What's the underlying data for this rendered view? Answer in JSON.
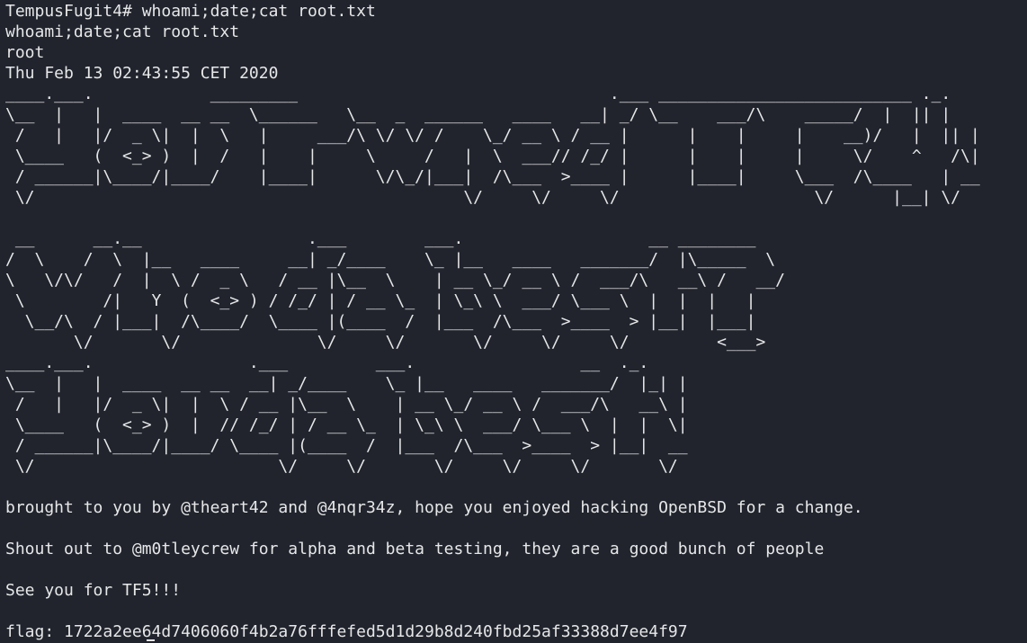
{
  "terminal": {
    "prompt_line": "TempusFugit4# whoami;date;cat root.txt",
    "echo_line": "whoami;date;cat root.txt",
    "user_line": "root",
    "date_line": "Thu Feb 13 02:43:55 CET 2020",
    "art1": [
      "____.___.            _________                                .___ __________________________ ._.",
      "\\__  |   |  ____  __ __  \\______   \\__  _  ______   ____   __| _/ \\__    ___/\\    _____/  |  || |",
      " /   |   |/  _ \\|  |  \\   |     ___/\\ \\/ \\/ /    \\_/ __ \\ / __ |      |    |     |    __)/   |  || |",
      " \\____   (  <_> )  |  /   |    |     \\     /   |  \\  ___// /_/ |      |    |     |     \\/    ^   /\\|",
      " / ______|\\____/|____/    |____|      \\/\\_/|___|  /\\___  >____ |      |____|     \\___  /\\____   | __",
      " \\/                                            \\/     \\/     \\/                    \\/      |__| \\/"
    ],
    "art2": [
      " __      __.__                 .___        ___.                   __ ________",
      "/  \\    /  \\  |__   ____     __| _/____    \\_ |__   ____   _______/  |\\_____  \\",
      "\\   \\/\\/   /  |  \\ /  _ \\   / __ |\\__  \\    | __ \\_/ __ \\ /  ___/\\   __\\ /   __/",
      " \\        /|   Y  (  <_> ) / /_/ | / __ \\_  | \\_\\ \\  ___/ \\___ \\  |  |  |   |",
      "  \\__/\\  / |___|  /\\____/  \\____ |(____  /  |___  /\\___  >____  > |__|  |___|",
      "       \\/       \\/              \\/     \\/       \\/     \\/     \\/         <___>"
    ],
    "art3": [
      "____.___.                .___         ___.                 __  ._.",
      "\\__  |   |  ____  __ __  __| _/____    \\_ |__   ____   _______/  |_| |",
      " /   |   |/  _ \\|  |  \\ / __ |\\__  \\    | __ \\_/ __ \\ /  ___/\\   __\\ |",
      " \\____   (  <_> )  |  // /_/ | / __ \\_  | \\_\\ \\  ___/ \\___ \\  |  |  \\|",
      " / ______|\\____/|____/ \\____ |(____  /  |___  /\\___  >____  > |__|  __",
      " \\/                         \\/     \\/       \\/     \\/     \\/       \\/"
    ],
    "credits_line": "brought to you by @theart42 and @4nqr34z, hope you enjoyed hacking OpenBSD for a change.",
    "shoutout_line": "Shout out to @m0tleycrew for alpha and beta testing, they are a good bunch of people",
    "see_you_line": "See you for TF5!!!",
    "flag_line": "flag: 1722a2ee64d7406060f4b2a76fffefed5d1d29b8d240fbd25af33388d7ee4f97"
  }
}
